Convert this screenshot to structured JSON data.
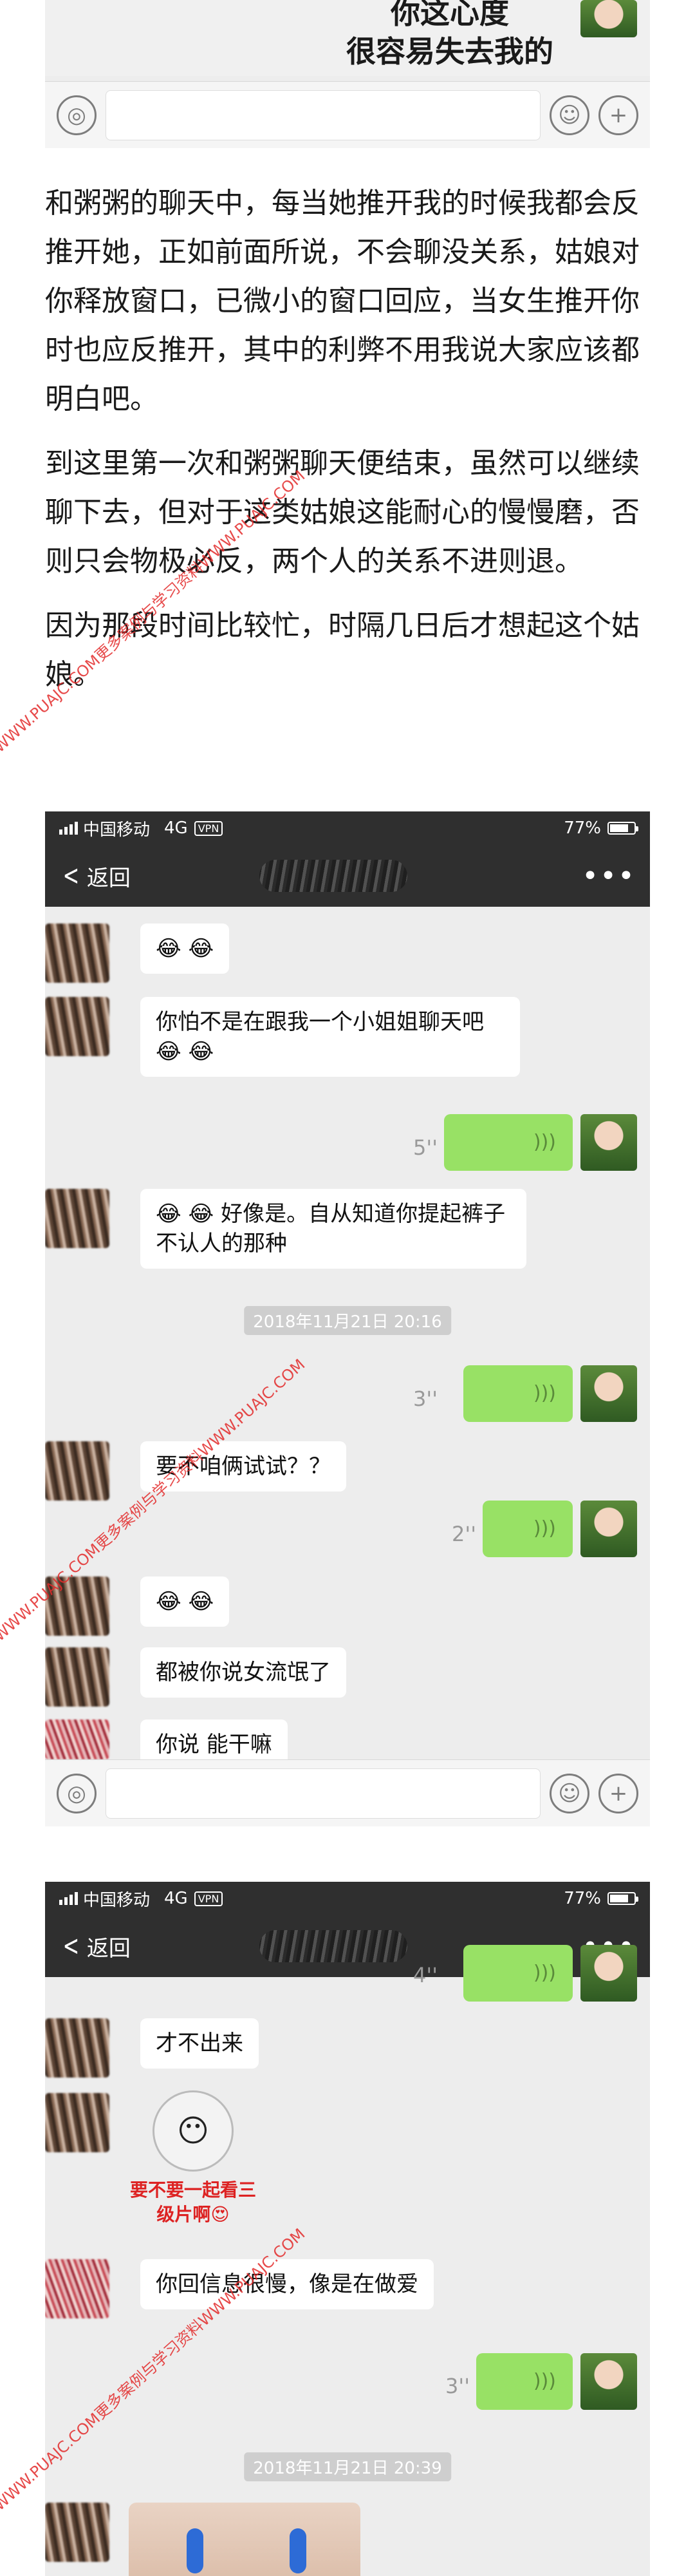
{
  "top_image": {
    "line1": "你这心度",
    "line2": "很容易失去我的"
  },
  "input_bar": {
    "voice_icon": "voice-icon",
    "emoji_icon": "emoji-icon",
    "plus_icon": "plus-icon"
  },
  "article": {
    "p1": "和粥粥的聊天中，每当她推开我的时候我都会反推开她，正如前面所说，不会聊没关系，姑娘对你释放窗口，已微小的窗口回应，当女生推开你时也应反推开，其中的利弊不用我说大家应该都明白吧。",
    "p2": "到这里第一次和粥粥聊天便结束，虽然可以继续聊下去，但对于这类姑娘这能耐心的慢慢磨，否则只会物极必反，两个人的关系不进则退。",
    "p3": "因为那段时间比较忙，时隔几日后才想起这个姑娘。"
  },
  "watermark": "WWW.PUAJC.COM更多案例与学习资料WWW.PUAJC.COM",
  "statusbar": {
    "carrier": "中国移动",
    "network": "4G",
    "vpn": "VPN",
    "battery": "77%",
    "battery_level": 0.77
  },
  "navbar": {
    "back_label": "返回",
    "more_icon": "•••"
  },
  "chat1": {
    "messages": [
      {
        "side": "left",
        "text": "😂 😂"
      },
      {
        "side": "left",
        "text": "你怕不是在跟我一个小姐姐聊天吧😂 😂"
      },
      {
        "side": "right",
        "voice": "5''"
      },
      {
        "side": "left",
        "text": "😂 😂 好像是。自从知道你提起裤子不认人的那种"
      },
      {
        "time": "2018年11月21日 20:16"
      },
      {
        "side": "right",
        "voice": "3''"
      },
      {
        "side": "left",
        "text": "要不咱俩试试？？"
      },
      {
        "side": "right",
        "voice": "2''"
      },
      {
        "side": "left",
        "text": "😂 😂"
      },
      {
        "side": "left",
        "text": "都被你说女流氓了"
      },
      {
        "side": "left",
        "text": "你说 能干嘛"
      }
    ]
  },
  "chat2": {
    "messages": [
      {
        "side": "right",
        "voice": "4''"
      },
      {
        "side": "left",
        "text": "才不出来"
      },
      {
        "side": "left",
        "sticker_caption": "要不要一起看三级片啊😍"
      },
      {
        "side": "left",
        "text": "你回信息很慢，像是在做爱"
      },
      {
        "side": "right",
        "voice": "3''"
      },
      {
        "time": "2018年11月21日 20:39"
      }
    ]
  }
}
